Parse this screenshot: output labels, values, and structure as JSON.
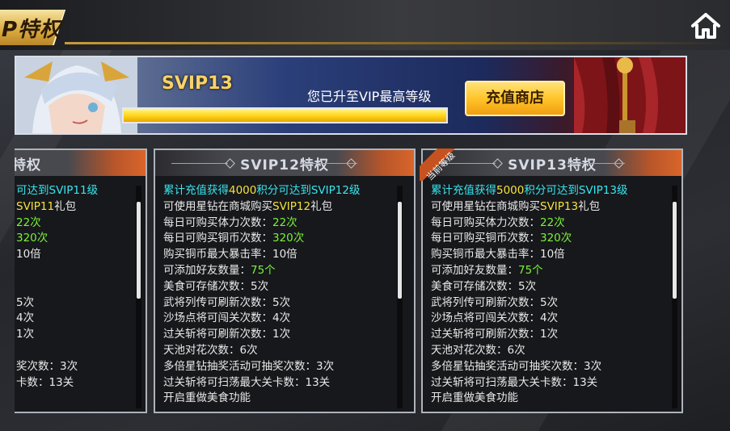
{
  "header": {
    "title": "P特权",
    "home_icon": "home-icon"
  },
  "banner": {
    "level": "SVIP13",
    "progress": 1.0,
    "max_text": "您已升至VIP最高等级",
    "shop_button": "充值商店"
  },
  "cards": [
    {
      "title": "特权",
      "lines": [
        [
          {
            "t": "可达到SVIP11级",
            "c": "cyan"
          }
        ],
        [
          {
            "t": "SVIP11",
            "c": "yellow"
          },
          {
            "t": "礼包",
            "c": ""
          }
        ],
        [
          {
            "t": "22次",
            "c": "green"
          }
        ],
        [
          {
            "t": "320次",
            "c": "green"
          }
        ],
        [
          {
            "t": "10倍",
            "c": ""
          }
        ],
        [
          {
            "t": "",
            "c": ""
          }
        ],
        [
          {
            "t": "",
            "c": ""
          }
        ],
        [
          {
            "t": "5次",
            "c": ""
          }
        ],
        [
          {
            "t": "4次",
            "c": ""
          }
        ],
        [
          {
            "t": "1次",
            "c": ""
          }
        ],
        [
          {
            "t": "",
            "c": ""
          }
        ],
        [
          {
            "t": "奖次数：3次",
            "c": ""
          }
        ],
        [
          {
            "t": "卡数：13关",
            "c": ""
          }
        ]
      ]
    },
    {
      "title": "SVIP12特权",
      "lines": [
        [
          {
            "t": "累计充值获得",
            "c": "cyan"
          },
          {
            "t": "4000",
            "c": "yellow"
          },
          {
            "t": "积分可达到SVIP12级",
            "c": "cyan"
          }
        ],
        [
          {
            "t": "可使用星钻在商城购买",
            "c": ""
          },
          {
            "t": "SVIP12",
            "c": "yellow"
          },
          {
            "t": "礼包",
            "c": ""
          }
        ],
        [
          {
            "t": "每日可购买体力次数：",
            "c": ""
          },
          {
            "t": "22次",
            "c": "green"
          }
        ],
        [
          {
            "t": "每日可购买铜币次数：",
            "c": ""
          },
          {
            "t": "320次",
            "c": "green"
          }
        ],
        [
          {
            "t": "购买铜币最大暴击率：10倍",
            "c": ""
          }
        ],
        [
          {
            "t": "可添加好友数量：",
            "c": ""
          },
          {
            "t": "75个",
            "c": "green"
          }
        ],
        [
          {
            "t": "美食可存储次数：5次",
            "c": ""
          }
        ],
        [
          {
            "t": "武将列传可刷新次数：5次",
            "c": ""
          }
        ],
        [
          {
            "t": "沙场点将可闯关次数：4次",
            "c": ""
          }
        ],
        [
          {
            "t": "过关斩将可刷新次数：1次",
            "c": ""
          }
        ],
        [
          {
            "t": "天池对花次数：6次",
            "c": ""
          }
        ],
        [
          {
            "t": "多倍星钻抽奖活动可抽奖次数：3次",
            "c": ""
          }
        ],
        [
          {
            "t": "过关斩将可扫荡最大关卡数：13关",
            "c": ""
          }
        ],
        [
          {
            "t": "开启重做美食功能",
            "c": ""
          }
        ]
      ]
    },
    {
      "title": "SVIP13特权",
      "badge": "当前等级",
      "lines": [
        [
          {
            "t": "累计充值获得",
            "c": "cyan"
          },
          {
            "t": "5000",
            "c": "yellow"
          },
          {
            "t": "积分可达到SVIP13级",
            "c": "cyan"
          }
        ],
        [
          {
            "t": "可使用星钻在商城购买",
            "c": ""
          },
          {
            "t": "SVIP13",
            "c": "yellow"
          },
          {
            "t": "礼包",
            "c": ""
          }
        ],
        [
          {
            "t": "每日可购买体力次数：",
            "c": ""
          },
          {
            "t": "22次",
            "c": "green"
          }
        ],
        [
          {
            "t": "每日可购买铜币次数：",
            "c": ""
          },
          {
            "t": "320次",
            "c": "green"
          }
        ],
        [
          {
            "t": "购买铜币最大暴击率：10倍",
            "c": ""
          }
        ],
        [
          {
            "t": "可添加好友数量：",
            "c": ""
          },
          {
            "t": "75个",
            "c": "green"
          }
        ],
        [
          {
            "t": "美食可存储次数：5次",
            "c": ""
          }
        ],
        [
          {
            "t": "武将列传可刷新次数：5次",
            "c": ""
          }
        ],
        [
          {
            "t": "沙场点将可闯关次数：4次",
            "c": ""
          }
        ],
        [
          {
            "t": "过关斩将可刷新次数：1次",
            "c": ""
          }
        ],
        [
          {
            "t": "天池对花次数：6次",
            "c": ""
          }
        ],
        [
          {
            "t": "多倍星钻抽奖活动可抽奖次数：3次",
            "c": ""
          }
        ],
        [
          {
            "t": "过关斩将可扫荡最大关卡数：13关",
            "c": ""
          }
        ],
        [
          {
            "t": "开启重做美食功能",
            "c": ""
          }
        ]
      ]
    }
  ]
}
